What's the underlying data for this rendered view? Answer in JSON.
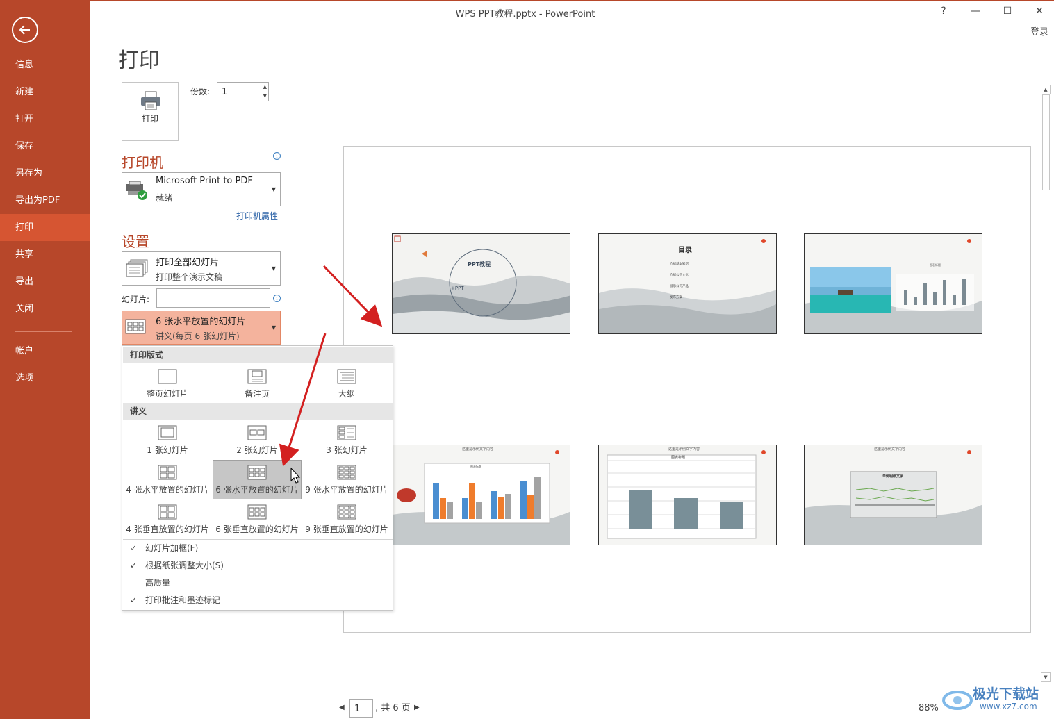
{
  "window": {
    "title": "WPS PPT教程.pptx - PowerPoint",
    "help": "?",
    "minimize": "—",
    "maximize": "☐",
    "close": "✕",
    "login": "登录"
  },
  "sidebar": {
    "items": [
      {
        "label": "信息"
      },
      {
        "label": "新建"
      },
      {
        "label": "打开"
      },
      {
        "label": "保存"
      },
      {
        "label": "另存为"
      },
      {
        "label": "导出为PDF"
      },
      {
        "label": "打印"
      },
      {
        "label": "共享"
      },
      {
        "label": "导出"
      },
      {
        "label": "关闭"
      },
      {
        "label": "帐户"
      },
      {
        "label": "选项"
      }
    ],
    "active": "打印",
    "bg_color": "#b7472a",
    "active_color": "#d65532"
  },
  "page": {
    "title": "打印"
  },
  "print": {
    "button_label": "打印",
    "copies_label": "份数:",
    "copies_value": "1"
  },
  "printer": {
    "heading": "打印机",
    "name": "Microsoft Print to PDF",
    "status": "就绪",
    "properties_link": "打印机属性"
  },
  "settings": {
    "heading": "设置",
    "range_title": "打印全部幻灯片",
    "range_sub": "打印整个演示文稿",
    "slides_label": "幻灯片:",
    "slides_value": "",
    "layout_title": "6 张水平放置的幻灯片",
    "layout_sub": "讲义(每页 6 张幻灯片)"
  },
  "layout_panel": {
    "group1": "打印版式",
    "group1_options": [
      "整页幻灯片",
      "备注页",
      "大纲"
    ],
    "group2": "讲义",
    "handout_options": [
      "1 张幻灯片",
      "2 张幻灯片",
      "3 张幻灯片",
      "4 张水平放置的幻灯片",
      "6 张水平放置的幻灯片",
      "9 张水平放置的幻灯片",
      "4 张垂直放置的幻灯片",
      "6 张垂直放置的幻灯片",
      "9 张垂直放置的幻灯片"
    ],
    "selected": "6 张水平放置的幻灯片",
    "checks": [
      {
        "label": "幻灯片加框(F)",
        "checked": true
      },
      {
        "label": "根据纸张调整大小(S)",
        "checked": true
      },
      {
        "label": "高质量",
        "checked": false
      },
      {
        "label": "打印批注和墨迹标记",
        "checked": true
      }
    ]
  },
  "preview": {
    "slides": [
      {
        "title": "PPT教程",
        "sub": "+PPT"
      },
      {
        "title": "目录",
        "items": [
          "介绍基本知识",
          "介绍公司文化",
          "展示公司产品",
          "发布方案"
        ]
      },
      {
        "title": "图表标题"
      },
      {
        "title": "这里是示例文字内容",
        "chart": "图表标题"
      },
      {
        "title": "这里是示例文字内容",
        "chart": "图表标题"
      },
      {
        "title": "这里是示例文字内容",
        "chart": "单例明细文字"
      }
    ]
  },
  "pager": {
    "current": "1",
    "total_text": ", 共 6 页",
    "zoom": "88%"
  },
  "watermark": {
    "text": "极光下载站",
    "url": "www.xz7.com"
  }
}
